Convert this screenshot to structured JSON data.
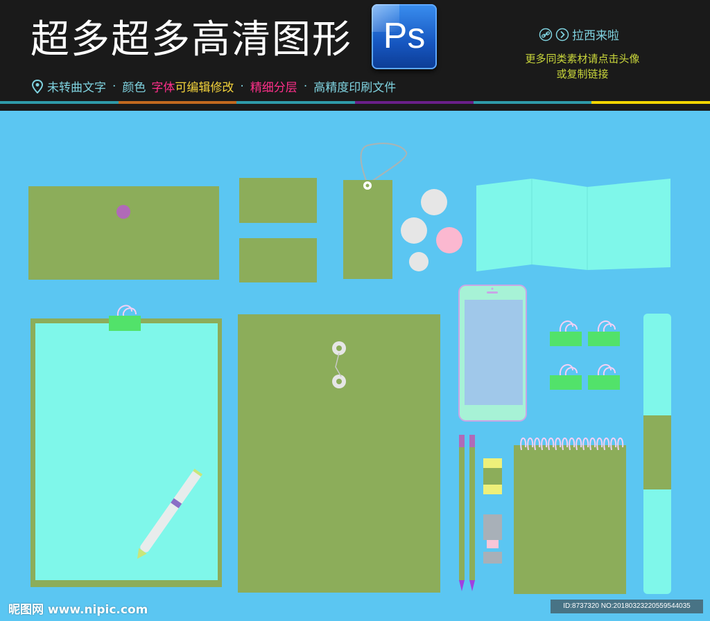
{
  "banner": {
    "headline": "超多超多高清图形",
    "ps_logo_text": "Ps",
    "features": [
      {
        "text": "未转曲文字",
        "color": "#7fd2df"
      },
      {
        "text": "颜色",
        "color": "#7fd2df"
      },
      {
        "text": "字体",
        "color": "#ff2f8a"
      },
      {
        "text": "可编辑修改",
        "color": "#f3d23b"
      },
      {
        "text": "精细分层",
        "color": "#ff2f8a"
      },
      {
        "text": "高精度印刷文件",
        "color": "#7fd2df"
      }
    ],
    "separator": "·",
    "strip_colors": [
      "#2f9aa8",
      "#c2691f",
      "#2f9aa8",
      "#6a1f8a",
      "#2f9aa8",
      "#f5d500"
    ],
    "promo_title": "拉西来啦",
    "promo_line1": "更多同类素材请点击头像",
    "promo_line2": "或复制链接"
  },
  "colors": {
    "background": "#5bc6f2",
    "olive": "#8cad5a",
    "aqua": "#7ff7ea",
    "clip_green": "#52e26a"
  },
  "watermark": {
    "site": "昵图网 www.nipic.com",
    "id_text": "ID:8737320 NO:20180323220559544035"
  }
}
